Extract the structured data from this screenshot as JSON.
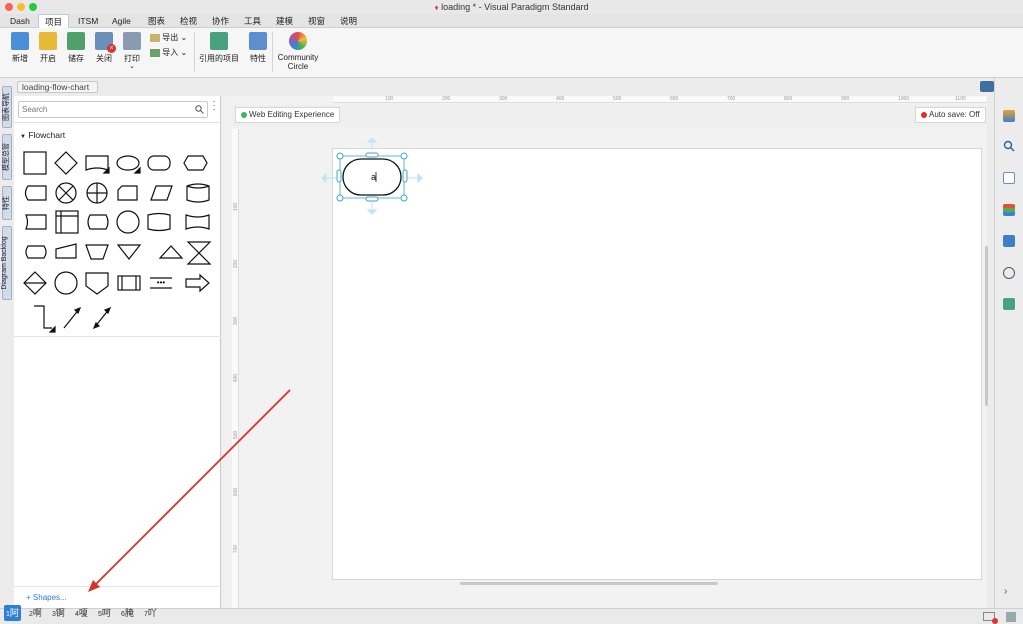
{
  "window": {
    "title": "loading * - Visual Paradigm Standard"
  },
  "menu": [
    "Dash",
    "项目",
    "ITSM",
    "Agile",
    "图表",
    "检视",
    "协作",
    "工具",
    "建模",
    "视窗",
    "说明"
  ],
  "ribbon": {
    "new": "新增",
    "open": "开启",
    "save": "储存",
    "close": "关闭",
    "print": "打印",
    "export": "导出",
    "import": "导入",
    "referenced": "引用的项目",
    "properties": "特性",
    "community_1": "Community",
    "community_2": "Circle"
  },
  "diagram_tab": "loading-flow-chart",
  "side_tabs": [
    "图表导航",
    "模型总管",
    "特性",
    "Diagram Backlog"
  ],
  "search": {
    "placeholder": "Search"
  },
  "palette": {
    "group": "Flowchart",
    "more_shapes": "Shapes..."
  },
  "canvas": {
    "web_editing": "Web Editing Experience",
    "auto_save": "Auto save: Off",
    "shape_text": "a",
    "ruler_top": [
      "100",
      "150",
      "200",
      "250",
      "300",
      "350",
      "400",
      "450",
      "500",
      "550",
      "600",
      "650",
      "700",
      "750",
      "800",
      "850",
      "900",
      "950",
      "1000",
      "1050",
      "1100"
    ],
    "ruler_left": [
      "100",
      "150",
      "200",
      "250",
      "300",
      "350",
      "400",
      "450",
      "500",
      "550",
      "600",
      "650",
      "700"
    ],
    "ruler_top_show": [
      "100",
      "200",
      "300",
      "400",
      "500",
      "600",
      "700",
      "800",
      "900",
      "1000",
      "1100"
    ],
    "ruler_left_show": [
      "100",
      "200",
      "300",
      "400",
      "500",
      "600",
      "700"
    ]
  },
  "ime": [
    {
      "n": "1",
      "c": "阿"
    },
    {
      "n": "2",
      "c": "啊"
    },
    {
      "n": "3",
      "c": "锕"
    },
    {
      "n": "4",
      "c": "嗄"
    },
    {
      "n": "5",
      "c": "呵"
    },
    {
      "n": "6",
      "c": "腌"
    },
    {
      "n": "7",
      "c": "吖"
    }
  ],
  "colors": {
    "accent": "#2f7fd6",
    "selection": "#3aa6c8",
    "arrow": "#d9302a"
  }
}
